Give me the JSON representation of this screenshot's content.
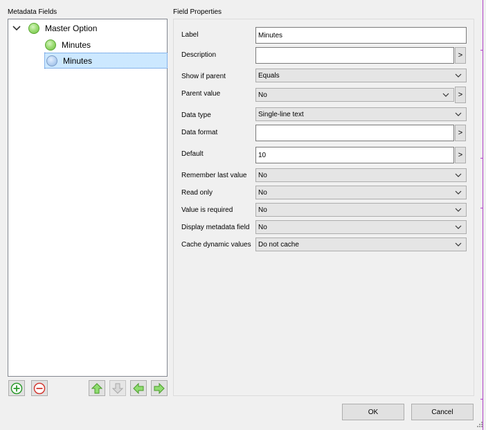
{
  "left_panel": {
    "title": "Metadata Fields",
    "tree": [
      {
        "label": "Master Option",
        "icon": "green-circle-icon",
        "level": 0,
        "expanded": true
      },
      {
        "label": "Minutes",
        "icon": "green-circle-icon",
        "level": 1
      },
      {
        "label": "Minutes",
        "icon": "blue-circle-icon",
        "level": 1,
        "selected": true
      }
    ],
    "buttons": [
      "add-icon",
      "remove-icon",
      "move-up-icon",
      "move-down-icon",
      "move-left-icon",
      "move-right-icon"
    ]
  },
  "right_panel": {
    "title": "Field Properties",
    "fields": {
      "label": {
        "label": "Label",
        "value": "Minutes"
      },
      "description": {
        "label": "Description",
        "value": ""
      },
      "show_if_parent": {
        "label": "Show if parent",
        "value": "Equals"
      },
      "parent_value": {
        "label": "Parent value",
        "value": "No"
      },
      "data_type": {
        "label": "Data type",
        "value": "Single-line text"
      },
      "data_format": {
        "label": "Data format",
        "value": ""
      },
      "default": {
        "label": "Default",
        "value": "10"
      },
      "remember_last": {
        "label": "Remember last value",
        "value": "No"
      },
      "read_only": {
        "label": "Read only",
        "value": "No"
      },
      "required": {
        "label": "Value is required",
        "value": "No"
      },
      "display_field": {
        "label": "Display metadata field",
        "value": "No"
      },
      "cache": {
        "label": "Cache dynamic values",
        "value": "Do not cache"
      }
    },
    "ellipsis": ">"
  },
  "dialog_buttons": {
    "ok": "OK",
    "cancel": "Cancel"
  },
  "colors": {
    "selection": "#cce8ff",
    "green": "#6cbf3e",
    "blue": "#8fb3de",
    "red": "#e0403a"
  }
}
